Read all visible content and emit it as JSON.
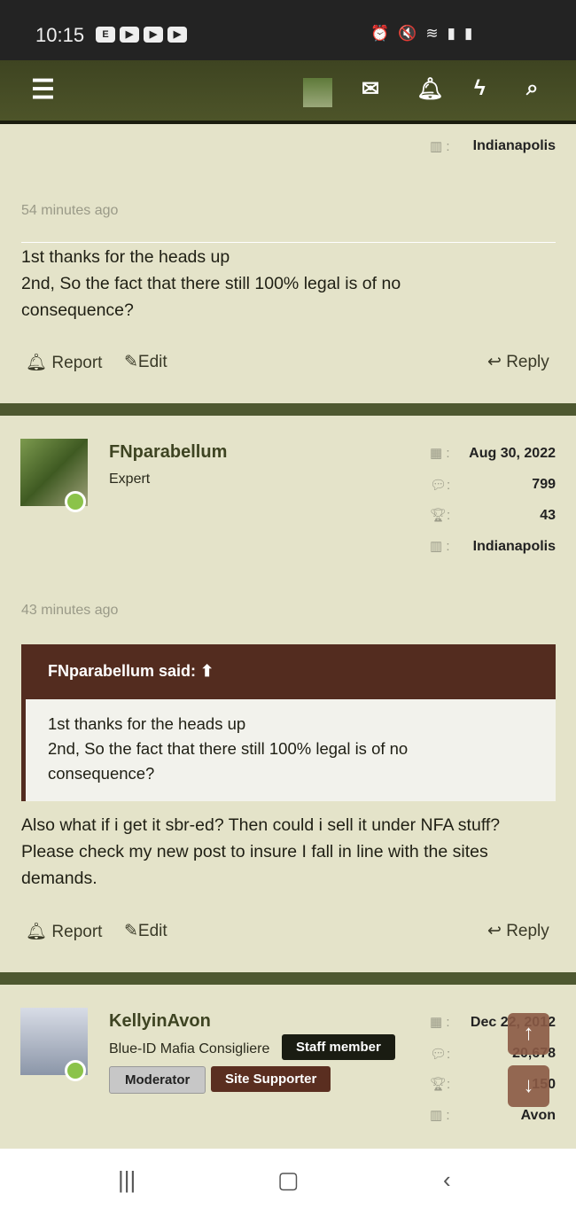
{
  "status": {
    "time": "10:15",
    "app_icons": [
      "E",
      "▶",
      "▶",
      "▶"
    ],
    "system_icons": [
      "alarm-icon",
      "mute-icon",
      "wifi-icon",
      "signal-icon",
      "battery-icon"
    ]
  },
  "topbar": {
    "icons": [
      "menu-icon",
      "avatar",
      "mail-icon",
      "bell-icon",
      "bolt-icon",
      "search-icon"
    ]
  },
  "post1": {
    "location": "Indianapolis",
    "time": "54 minutes ago",
    "body": [
      "1st thanks for the heads up",
      "2nd, So the fact that there still 100% legal is of no",
      "consequence?"
    ],
    "report": "Report",
    "edit": "Edit",
    "reply": "Reply"
  },
  "post2": {
    "username": "FNparabellum",
    "user_title": "Expert",
    "joined": "Aug 30, 2022",
    "messages": "799",
    "reactions": "43",
    "location": "Indianapolis",
    "time": "43 minutes ago",
    "quote": {
      "header": "FNparabellum said:",
      "lines": [
        "1st thanks for the heads up",
        "2nd, So the fact that there still 100% legal is of no",
        "consequence?"
      ]
    },
    "body": [
      "Also what if i get it sbr-ed? Then could i sell it under NFA stuff?",
      "Please check my new post to insure I fall in line with the sites",
      "demands."
    ],
    "report": "Report",
    "edit": "Edit",
    "reply": "Reply"
  },
  "post3": {
    "username": "KellyinAvon",
    "user_title": "Blue-ID Mafia Consigliere",
    "badges": {
      "staff": "Staff member",
      "moderator": "Moderator",
      "supporter": "Site Supporter"
    },
    "joined": "Dec 22, 2012",
    "messages": "20,678",
    "reactions": "150",
    "location": "Avon"
  },
  "colors": {
    "olive": "#4e5830",
    "quote": "#532c1f",
    "background": "#e4e3c9"
  }
}
